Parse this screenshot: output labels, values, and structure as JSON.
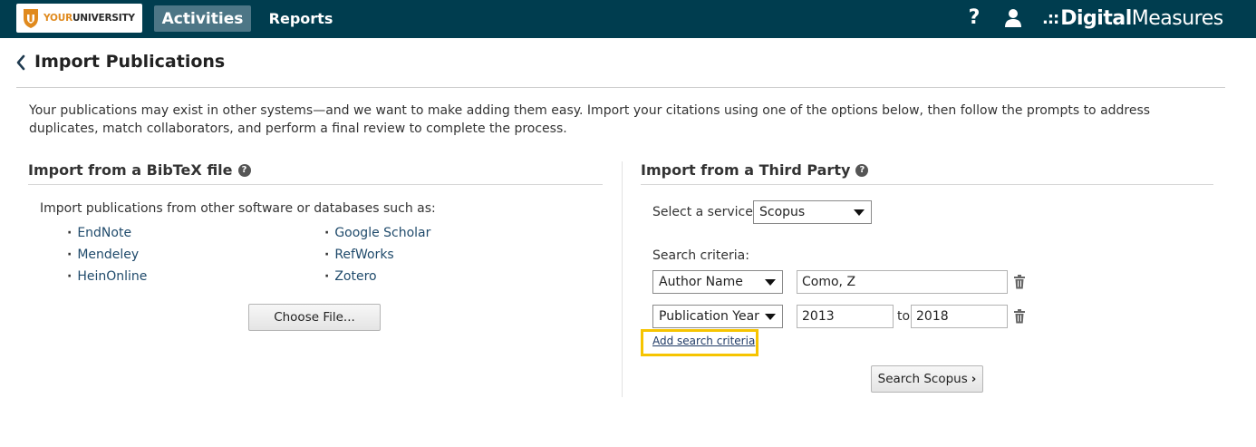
{
  "header": {
    "logo_part1": "YOUR",
    "logo_part2": "UNIVERSITY",
    "nav": {
      "activities": "Activities",
      "reports": "Reports"
    },
    "help": "?",
    "brand_dots": ".::",
    "brand_part1": "Digital",
    "brand_part2": "Measures"
  },
  "page": {
    "title": "Import Publications",
    "intro": "Your publications may exist in other systems—and we want to make adding them easy. Import your citations using one of the options below, then follow the prompts to address duplicates, match collaborators, and perform a final review to complete the process."
  },
  "bibtex": {
    "title": "Import from a BibTeX file",
    "help": "?",
    "description": "Import publications from other software or databases such as:",
    "sources_col1": [
      "EndNote",
      "Mendeley",
      "HeinOnline"
    ],
    "sources_col2": [
      "Google Scholar",
      "RefWorks",
      "Zotero"
    ],
    "choose_button": "Choose File..."
  },
  "third_party": {
    "title": "Import from a Third Party",
    "help": "?",
    "service_label": "Select a service",
    "service_value": "Scopus",
    "criteria_label": "Search criteria:",
    "criteria": [
      {
        "field": "Author Name",
        "value": "Como, Z"
      },
      {
        "field": "Publication Year",
        "from": "2013",
        "to_label": "to",
        "to": "2018"
      }
    ],
    "add_criteria": "Add search criteria",
    "search_button": "Search Scopus",
    "search_chevron": "›"
  },
  "colors": {
    "topbar": "#003d4f",
    "active_tab": "#4d7686",
    "link": "#1f4a6b",
    "highlight": "#f6c400"
  }
}
